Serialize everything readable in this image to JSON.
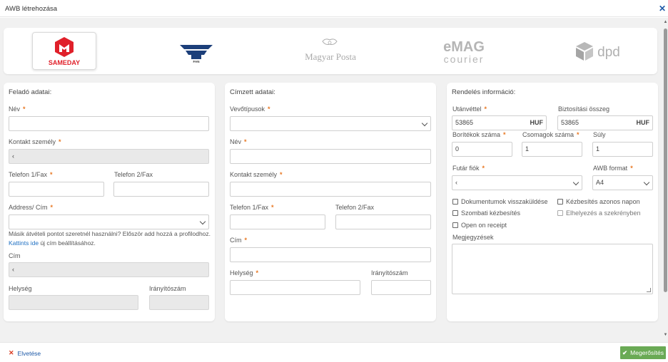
{
  "dialog": {
    "title": "AWB létrehozása"
  },
  "carriers": [
    {
      "name": "SAMEDAY",
      "selected": true
    },
    {
      "name": "FAN",
      "selected": false
    },
    {
      "name": "Magyar Posta",
      "selected": false
    },
    {
      "name": "eMAG courier",
      "selected": false,
      "word1": "eMAG",
      "word2": "courier"
    },
    {
      "name": "dpd",
      "selected": false
    }
  ],
  "sender": {
    "title": "Feladó adatai:",
    "name_label": "Név",
    "contact_label": "Kontakt személy",
    "contact_value": "‹",
    "phone1_label": "Telefon 1/Fax",
    "phone2_label": "Telefon 2/Fax",
    "address_label": "Address/ Cím",
    "help_text": "Másik átvételi pontot szeretnél használni? Először add hozzá a profilodhoz.",
    "help_link": "Kattints ide",
    "help_tail": "új cím beállításához.",
    "cim_label": "Cím",
    "cim_value": "‹",
    "city_label": "Helység",
    "zip_label": "Irányítószám"
  },
  "recipient": {
    "title": "Címzett adatai:",
    "customer_type_label": "Vevőtípusok",
    "name_label": "Név",
    "contact_label": "Kontakt személy",
    "phone1_label": "Telefon 1/Fax",
    "phone2_label": "Telefon 2/Fax",
    "cim_label": "Cím",
    "city_label": "Helység",
    "zip_label": "Irányítószám"
  },
  "order": {
    "title": "Rendelés információ:",
    "cod_label": "Utánvéttel",
    "cod_value": "53865",
    "cod_currency": "HUF",
    "insurance_label": "Biztosítási összeg",
    "insurance_value": "53865",
    "insurance_currency": "HUF",
    "envelopes_label": "Borítékok száma",
    "envelopes_value": "0",
    "packages_label": "Csomagok száma",
    "packages_value": "1",
    "weight_label": "Súly",
    "weight_value": "1",
    "courier_label": "Futár fiók",
    "courier_value": "‹",
    "awb_format_label": "AWB format",
    "awb_format_value": "A4",
    "checkboxes": [
      "Dokumentumok visszaküldése",
      "Kézbesítés azonos napon",
      "Szombati kézbesítés",
      "Elhelyezés a szekrényben",
      "Open on receipt"
    ],
    "notes_label": "Megjegyzések"
  },
  "footer": {
    "cancel_label": "Elvetése",
    "confirm_label": "Megerősítés"
  },
  "colors": {
    "required": "#e87722",
    "confirm": "#6aaa55",
    "link": "#1e6fc2",
    "sameday_red": "#e0202a",
    "fan_blue": "#1c3f7a"
  }
}
